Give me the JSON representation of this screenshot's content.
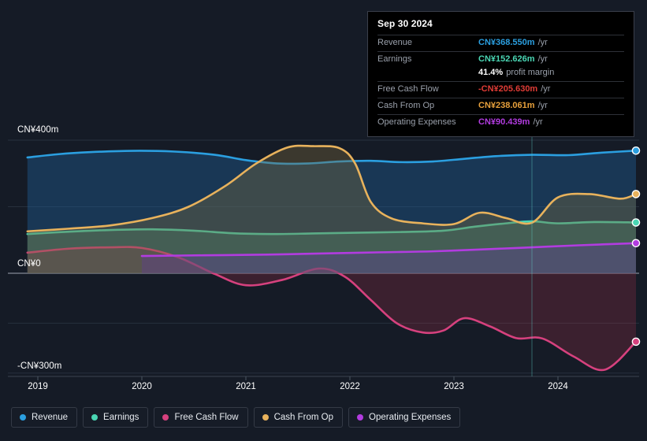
{
  "theme": {
    "background": "#151b26",
    "tooltip_background": "#000000",
    "tooltip_border": "#3a3f4a",
    "gridline": "#2b3442",
    "zero_line": "#8f97a3",
    "text": "#ffffff",
    "muted_text": "#9aa0ab"
  },
  "tooltip": {
    "date": "Sep 30 2024",
    "rows": [
      {
        "key": "Revenue",
        "value": "CN¥368.550m",
        "unit": "/yr",
        "color": "#2b9fe0"
      },
      {
        "key": "Earnings",
        "value": "CN¥152.626m",
        "unit": "/yr",
        "color": "#4ad6b4"
      },
      {
        "key": "",
        "value": "41.4%",
        "unit": "profit margin",
        "color": "#ffffff"
      },
      {
        "key": "Free Cash Flow",
        "value": "-CN¥205.630m",
        "unit": "/yr",
        "color": "#e03c36"
      },
      {
        "key": "Cash From Op",
        "value": "CN¥238.061m",
        "unit": "/yr",
        "color": "#e8a13c"
      },
      {
        "key": "Operating Expenses",
        "value": "CN¥90.439m",
        "unit": "/yr",
        "color": "#b23ce0"
      }
    ]
  },
  "legend": {
    "items": [
      {
        "label": "Revenue",
        "color": "#2b9fe0"
      },
      {
        "label": "Earnings",
        "color": "#4ad6b4"
      },
      {
        "label": "Free Cash Flow",
        "color": "#d6417e"
      },
      {
        "label": "Cash From Op",
        "color": "#e8b25c"
      },
      {
        "label": "Operating Expenses",
        "color": "#b23ce0"
      }
    ]
  },
  "chart_data": {
    "type": "area",
    "title": "",
    "xlabel": "",
    "ylabel": "",
    "currency": "CN¥",
    "units": "millions per year",
    "grid": true,
    "legend_position": "bottom",
    "xlim": [
      2018.75,
      2024.85
    ],
    "ylim": [
      -340,
      430
    ],
    "x_ticks": [
      "2019",
      "2020",
      "2021",
      "2022",
      "2023",
      "2024"
    ],
    "x_tick_values": [
      2019,
      2020,
      2021,
      2022,
      2023,
      2024
    ],
    "y_ticks": [
      "CN¥400m",
      "CN¥0",
      "-CN¥300m"
    ],
    "y_tick_values": [
      400,
      0,
      -300
    ],
    "gridline_values": [
      400,
      200,
      0,
      -150,
      -300
    ],
    "hover_x": 2023.75,
    "hover_label": "Sep 30 2024",
    "series": [
      {
        "name": "Revenue",
        "color": "#2b9fe0",
        "fill": "rgba(30,95,150,0.42)",
        "x": [
          2018.9,
          2019.2,
          2019.5,
          2019.9,
          2020.3,
          2020.7,
          2021.0,
          2021.3,
          2021.6,
          2021.9,
          2022.2,
          2022.5,
          2022.8,
          2023.1,
          2023.4,
          2023.75,
          2024.1,
          2024.4,
          2024.75
        ],
        "values": [
          348,
          358,
          364,
          368,
          366,
          356,
          340,
          330,
          330,
          336,
          338,
          334,
          336,
          344,
          352,
          356,
          355,
          362,
          368.55
        ]
      },
      {
        "name": "Earnings",
        "color": "#4ad6b4",
        "fill": "rgba(52,130,120,0.42)",
        "x": [
          2018.9,
          2019.3,
          2019.7,
          2020.1,
          2020.5,
          2020.9,
          2021.3,
          2021.7,
          2022.1,
          2022.5,
          2022.9,
          2023.2,
          2023.5,
          2023.75,
          2024.0,
          2024.35,
          2024.75
        ],
        "values": [
          118,
          125,
          130,
          132,
          128,
          120,
          118,
          120,
          122,
          124,
          128,
          140,
          150,
          156,
          150,
          154,
          152.626
        ]
      },
      {
        "name": "Free Cash Flow",
        "color": "#d6417e",
        "fill": "rgba(150,45,70,0.30)",
        "x": [
          2018.9,
          2019.3,
          2019.7,
          2020.0,
          2020.35,
          2020.7,
          2021.0,
          2021.35,
          2021.7,
          2021.95,
          2022.2,
          2022.45,
          2022.7,
          2022.9,
          2023.1,
          2023.35,
          2023.6,
          2023.85,
          2024.15,
          2024.45,
          2024.75
        ],
        "values": [
          62,
          74,
          78,
          76,
          48,
          -2,
          -36,
          -20,
          14,
          -10,
          -80,
          -150,
          -178,
          -172,
          -135,
          -160,
          -195,
          -196,
          -250,
          -290,
          -205.63
        ]
      },
      {
        "name": "Cash From Op",
        "color": "#e8b25c",
        "fill": "rgba(120,105,60,0.38)",
        "x": [
          2018.9,
          2019.3,
          2019.7,
          2020.1,
          2020.45,
          2020.8,
          2021.1,
          2021.4,
          2021.65,
          2021.9,
          2022.05,
          2022.2,
          2022.4,
          2022.7,
          2023.0,
          2023.25,
          2023.5,
          2023.75,
          2024.0,
          2024.3,
          2024.6,
          2024.75
        ],
        "values": [
          126,
          134,
          144,
          166,
          200,
          262,
          330,
          378,
          382,
          376,
          330,
          215,
          165,
          150,
          148,
          182,
          166,
          152,
          228,
          238,
          224,
          238.061
        ]
      },
      {
        "name": "Operating Expenses",
        "color": "#b23ce0",
        "fill": "rgba(95,60,150,0.38)",
        "start_x": 2020.0,
        "x": [
          2020.0,
          2020.6,
          2021.2,
          2021.8,
          2022.3,
          2022.8,
          2023.3,
          2023.75,
          2024.2,
          2024.75
        ],
        "values": [
          52,
          54,
          56,
          60,
          63,
          66,
          72,
          78,
          84,
          90.439
        ]
      }
    ],
    "endpoint_markers": [
      {
        "series": "Revenue",
        "value": 368.55,
        "color": "#2b9fe0"
      },
      {
        "series": "Cash From Op",
        "value": 238.061,
        "color": "#e8b25c"
      },
      {
        "series": "Earnings",
        "value": 152.626,
        "color": "#4ad6b4"
      },
      {
        "series": "Operating Expenses",
        "value": 90.439,
        "color": "#b23ce0"
      },
      {
        "series": "Free Cash Flow",
        "value": -205.63,
        "color": "#d6417e"
      }
    ]
  }
}
